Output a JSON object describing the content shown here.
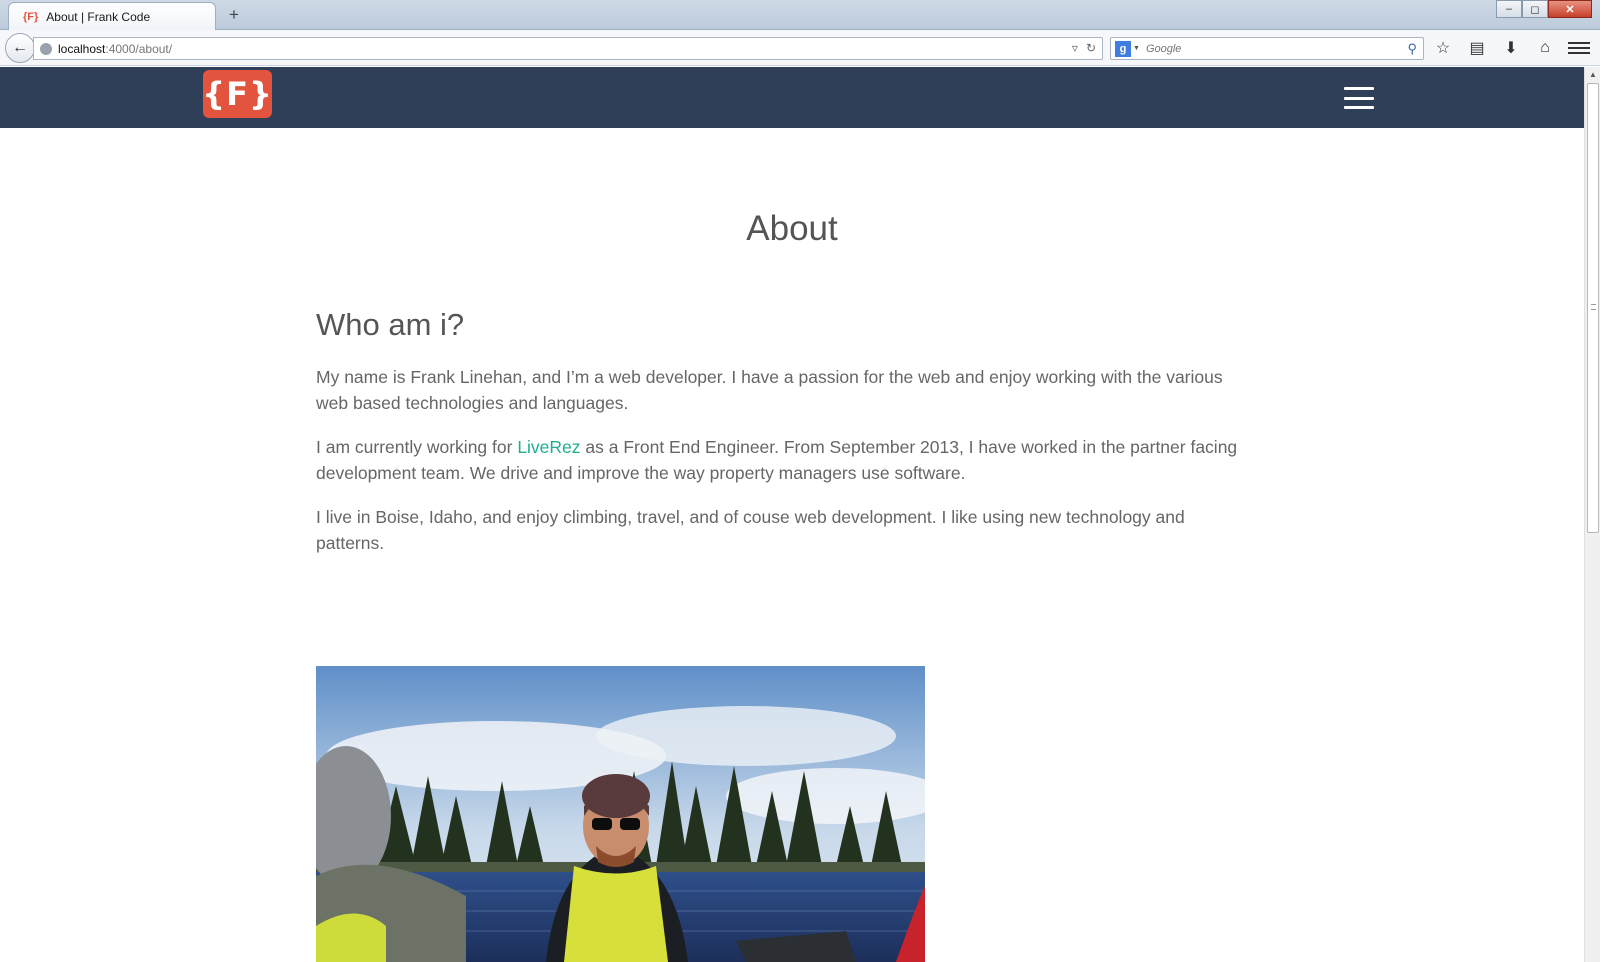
{
  "browser": {
    "tab_favicon": "{F}",
    "tab_title": "About | Frank Code",
    "new_tab": "+",
    "url_host": "localhost",
    "url_path": ":4000/about/",
    "search_engine_letter": "g",
    "search_placeholder": "Google"
  },
  "site": {
    "logo_text": "{F}"
  },
  "page": {
    "title": "About",
    "section_title": "Who am i?",
    "para1": "My name is Frank Linehan, and I’m a web developer. I have a passion for the web and enjoy working with the various web based technologies and languages.",
    "para2_before": "I am currently working for ",
    "para2_link": "LiveRez",
    "para2_after": " as a Front End Engineer. From September 2013, I have worked in the partner facing development team. We drive and improve the way property managers use software.",
    "para3": "I live in Boise, Idaho, and enjoy climbing, travel, and of couse web development. I like using new technology and patterns."
  },
  "colors": {
    "header_bg": "#2f3f57",
    "logo_bg": "#e2543d",
    "link": "#1fae8f",
    "text": "#666666"
  }
}
